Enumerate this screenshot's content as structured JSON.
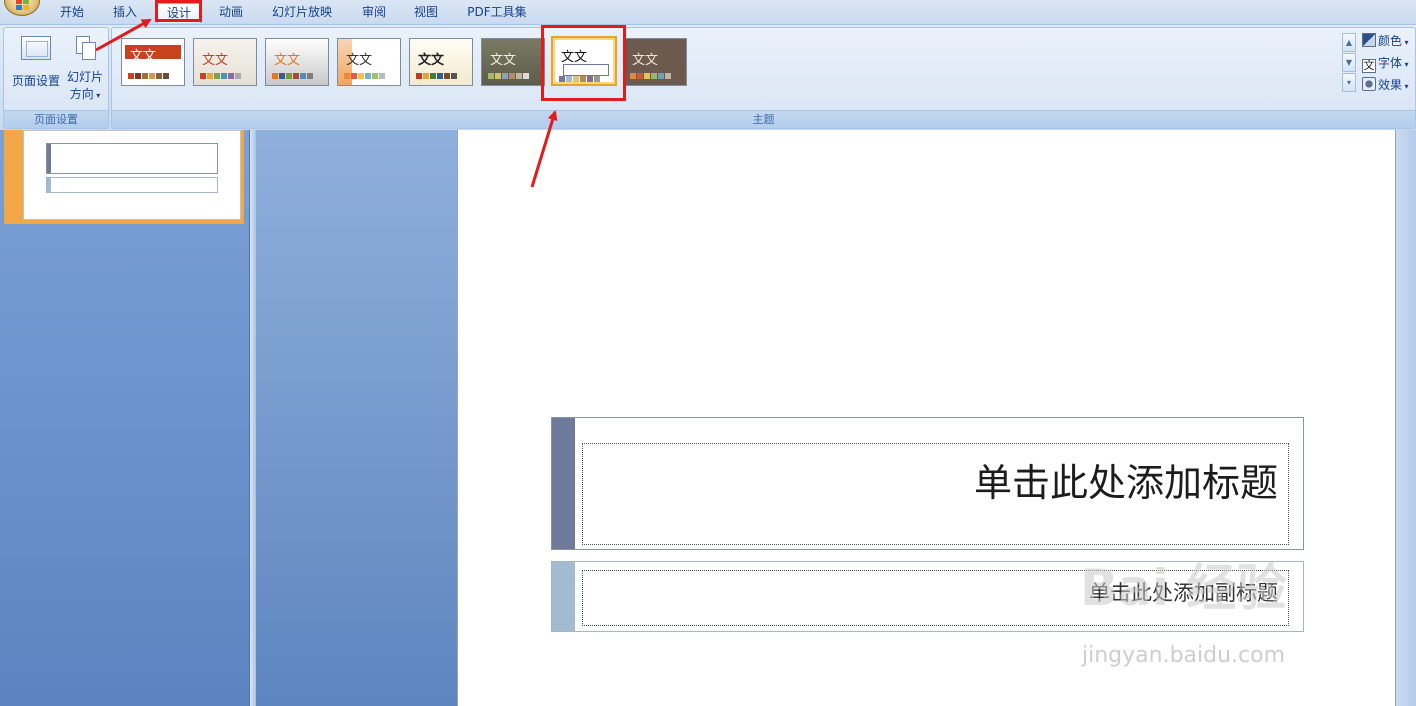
{
  "tabs": [
    {
      "label": "开始"
    },
    {
      "label": "插入"
    },
    {
      "label": "设计"
    },
    {
      "label": "动画"
    },
    {
      "label": "幻灯片放映"
    },
    {
      "label": "审阅"
    },
    {
      "label": "视图"
    },
    {
      "label": "PDF工具集"
    }
  ],
  "active_tab": "设计",
  "page_setup_group": {
    "page_setup_label": "页面设置",
    "orientation_label_line1": "幻灯片",
    "orientation_label_line2": "方向",
    "group_label": "页面设置"
  },
  "themes_group": {
    "group_label": "主题",
    "theme_sample_text": "文文",
    "selected_theme_index": 6,
    "options": {
      "colors": "颜色",
      "fonts": "字体",
      "effects": "效果"
    }
  },
  "slide": {
    "title_placeholder": "单击此处添加标题",
    "subtitle_placeholder": "单击此处添加副标题"
  },
  "watermark": {
    "brand": "Bai 经验",
    "url": "jingyan.baidu.com"
  },
  "colors": {
    "annotation_red": "#e21b1b",
    "title_bar": "#6f7a9b",
    "subtitle_bar": "#a3bbd0",
    "selection_orange": "#f4a746"
  }
}
